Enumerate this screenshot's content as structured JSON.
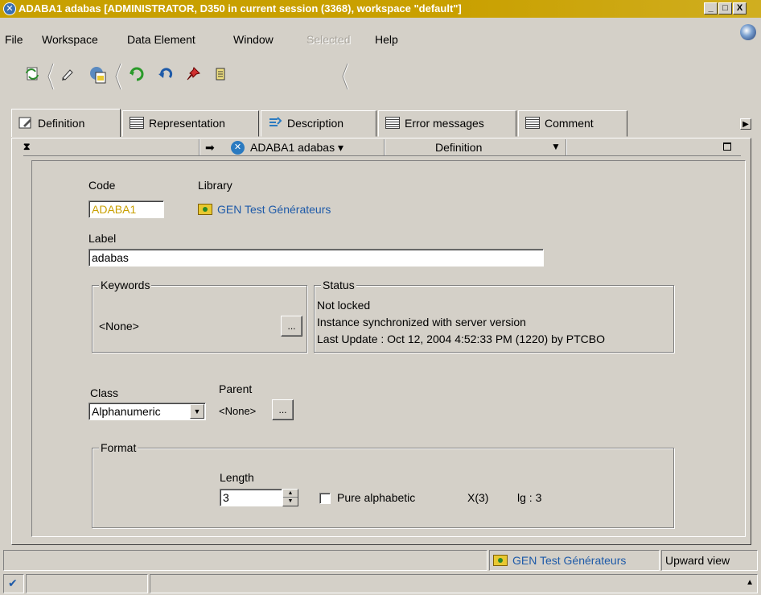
{
  "window": {
    "title": "ADABA1 adabas [ADMINISTRATOR, D350 in current session (3368), workspace \"default\"]",
    "minimize": "_",
    "maximize": "□",
    "close": "X"
  },
  "menu": {
    "file": "File",
    "workspace": "Workspace",
    "data_element": "Data Element",
    "window": "Window",
    "selected": "Selected",
    "help": "Help"
  },
  "tabs": [
    {
      "label": "Definition",
      "icon": "definition-icon"
    },
    {
      "label": "Representation",
      "icon": "list-icon"
    },
    {
      "label": "Description",
      "icon": "description-icon"
    },
    {
      "label": "Error messages",
      "icon": "list-icon"
    },
    {
      "label": "Comment",
      "icon": "list-icon"
    }
  ],
  "panel_header": {
    "object": "ADABA1 adabas",
    "view": "Definition"
  },
  "form": {
    "code_label": "Code",
    "code_value": "ADABA1",
    "library_label": "Library",
    "library_value": "GEN Test Générateurs",
    "label_label": "Label",
    "label_value": "adabas",
    "keywords_legend": "Keywords",
    "keywords_value": "<None>",
    "dots": "...",
    "status_legend": "Status",
    "status_lines": [
      "Not locked",
      "Instance synchronized with server version",
      "Last Update : Oct 12, 2004 4:52:33 PM (1220) by PTCBO"
    ],
    "class_label": "Class",
    "class_value": "Alphanumeric",
    "parent_label": "Parent",
    "parent_value": "<None>",
    "format_legend": "Format",
    "length_label": "Length",
    "length_value": "3",
    "pure_alpha_label": "Pure alphabetic",
    "picture": "X(3)",
    "lg": "lg : 3"
  },
  "statusbar": {
    "library": "GEN Test Générateurs",
    "view": "Upward view"
  },
  "colors": {
    "titlebar": "#c9a000",
    "face": "#d4d0c8",
    "link": "#1e5aa8"
  }
}
